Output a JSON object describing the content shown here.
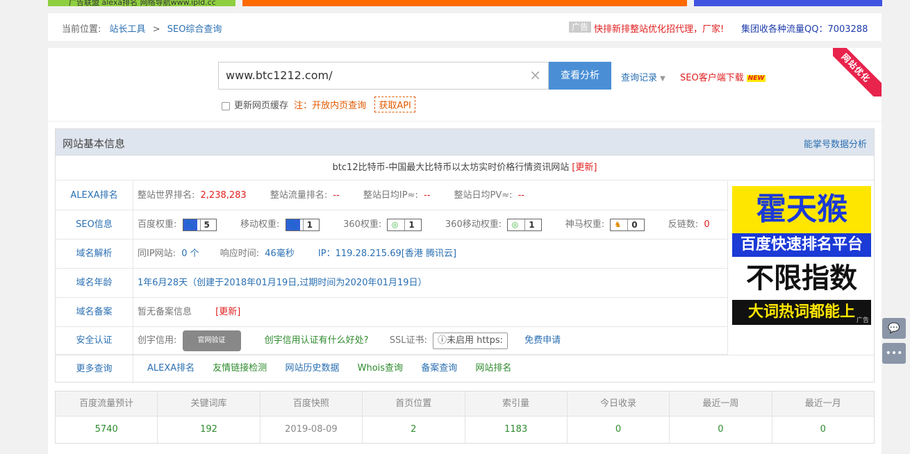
{
  "top_ads": {
    "ad1_text": "广告联盟 alexa排名 网络导航www.ipld.cc"
  },
  "breadcrumb": {
    "label": "当前位置:",
    "items": [
      "站长工具",
      "SEO综合查询"
    ],
    "separator": ">"
  },
  "header_promo": {
    "ad_tag": "广告",
    "promo_text": "快排新排整站优化招代理，厂家!",
    "qq_text": "集团收各种流量QQ：7003288"
  },
  "corner_ribbon": "网站优化",
  "search": {
    "value": "www.btc1212.com/",
    "clear_icon": "×",
    "submit_label": "查看分析",
    "history_label": "查询记录",
    "client_label": "SEO客户端下载",
    "new_badge": "NEW"
  },
  "options": {
    "refresh_cache_label": "更新网页缓存",
    "note_label": "注：开放内页查询",
    "api_label": "获取API"
  },
  "info": {
    "title": "网站基本信息",
    "right_link": "能掌号数据分析",
    "site_title": "btc12比特币-中国最大比特币以太坊实时价格行情资讯网站",
    "site_update": "[更新]",
    "alexa": {
      "key": "ALEXA排名",
      "world_rank_label": "整站世界排名:",
      "world_rank_value": "2,238,283",
      "traffic_rank_label": "整站流量排名:",
      "traffic_rank_value": "--",
      "daily_ip_label": "整站日均IP≈:",
      "daily_ip_value": "--",
      "daily_pv_label": "整站日均PV≈:",
      "daily_pv_value": "--"
    },
    "seo": {
      "key": "SEO信息",
      "baidu_label": "百度权重:",
      "baidu_value": "5",
      "mobile_label": "移动权重:",
      "mobile_value": "1",
      "s360_label": "360权重:",
      "s360_value": "1",
      "s360m_label": "360移动权重:",
      "s360m_value": "1",
      "shenma_label": "神马权重:",
      "shenma_value": "0",
      "backlinks_label": "反链数:",
      "backlinks_value": "0"
    },
    "dns": {
      "key": "域名解析",
      "same_ip_label": "同IP网站:",
      "same_ip_value": "0 个",
      "resp_label": "响应时间:",
      "resp_value": "46毫秒",
      "ip_label": "IP：119.28.215.69[香港 腾讯云]"
    },
    "age": {
      "key": "域名年龄",
      "value": "1年6月28天（创建于2018年01月19日,过期时间为2020年01月19日）"
    },
    "icp": {
      "key": "域名备案",
      "value": "暂无备案信息",
      "update": "[更新]"
    },
    "security": {
      "key": "安全认证",
      "credit_label": "创宇信用:",
      "shield_text": "官网验证",
      "credit_link": "创宇信用认证有什么好处?",
      "ssl_label": "SSL证书:",
      "ssl_status": "ⓘ未启用 https:",
      "ssl_link": "免费申请"
    },
    "more": {
      "key": "更多查询",
      "links": [
        "ALEXA排名",
        "友情链接检测",
        "网站历史数据",
        "Whois查询",
        "备案查询",
        "网站排名"
      ]
    }
  },
  "side_ad": {
    "line1": "霍天猴",
    "line2": "百度快速排名平台",
    "line3": "不限指数",
    "line4": "大词热词都能上",
    "tag": "广告"
  },
  "stats": {
    "headers": [
      "百度流量预计",
      "关键词库",
      "百度快照",
      "首页位置",
      "索引量",
      "今日收录",
      "最近一周",
      "最近一月"
    ],
    "values": [
      "5740",
      "192",
      "2019-08-09",
      "2",
      "1183",
      "0",
      "0",
      "0"
    ]
  },
  "side_buttons": {
    "feedback_icon": "💬",
    "more_icon": "•••"
  }
}
